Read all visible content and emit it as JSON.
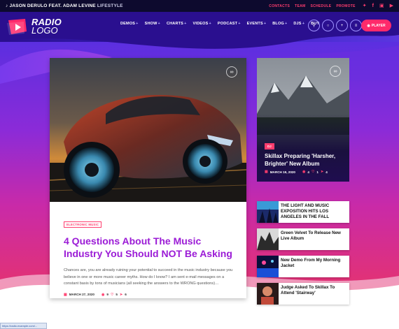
{
  "topbar": {
    "now_playing_artist": "JASON DERULO FEAT. ADAM LEVINE",
    "now_playing_song": "LIFESTYLE",
    "links": [
      "CONTACTS",
      "TEAM",
      "SCHEDULE",
      "PROMOTE"
    ],
    "social_icons": [
      "twitter-icon",
      "facebook-icon",
      "instagram-icon",
      "youtube-icon"
    ]
  },
  "logo": {
    "line1": "RADIO",
    "line2": "LOGO"
  },
  "nav": {
    "items": [
      {
        "label": "DEMOS",
        "has_sub": true
      },
      {
        "label": "SHOW",
        "has_sub": true
      },
      {
        "label": "CHARTS",
        "has_sub": true
      },
      {
        "label": "VIDEOS",
        "has_sub": true
      },
      {
        "label": "PODCAST",
        "has_sub": true
      },
      {
        "label": "EVENTS",
        "has_sub": true
      },
      {
        "label": "BLOG",
        "has_sub": true
      },
      {
        "label": "DJS",
        "has_sub": true
      },
      {
        "label": "BUY",
        "has_sub": false
      }
    ],
    "plus_glyph": "+",
    "circle_icons": [
      "search-icon",
      "cart-icon",
      "add-icon",
      "menu-icon"
    ],
    "player_label": "PLAYER"
  },
  "main_post": {
    "category": "ELECTRONIC MUSIC",
    "title": "4 Questions About The Music Industry You Should NOT Be Asking",
    "excerpt": "Chances are, you are already ruining your potential to succeed in the music industry because you believe in one or more music career myths. How do I know? I am sent e-mail messages on a constant basis by tons of musicians (all seeking the answers to the WRONG questions)…",
    "date": "MARCH 27, 2020",
    "views": "9",
    "likes": "5",
    "shares": "6"
  },
  "side_feature": {
    "category": "DJ",
    "title": "Skillax Preparing 'Harsher, Brighter' New Album",
    "date": "MARCH 19, 2020",
    "views": "4",
    "likes": "1",
    "shares": "4"
  },
  "side_list": [
    {
      "title": "THE LIGHT AND MUSIC EXPOSITION HITS LOS ANGELES IN THE FALL"
    },
    {
      "title": "Green Velvet To Release New Live Album"
    },
    {
      "title": "New Demo From My Morning Jacket"
    },
    {
      "title": "Judge Asked To Skillax To Attend 'Stairway'"
    }
  ],
  "statusbar": {
    "text": "https://radio.example.com/..."
  },
  "colors": {
    "accent_pink": "#ff3d6e",
    "title_purple": "#9b1bd6",
    "topbar_bg": "#0d0a2e"
  }
}
